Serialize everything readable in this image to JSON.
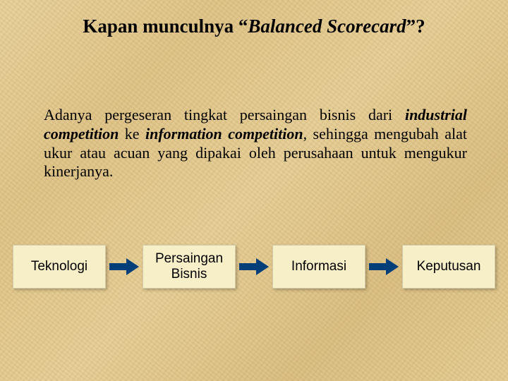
{
  "title": {
    "pre": "Kapan munculnya “",
    "italic": "Balanced Scorecard",
    "post": "”?"
  },
  "paragraph": {
    "p1": "Adanya pergeseran tingkat persaingan bisnis dari ",
    "industrial_competition": "industrial competition",
    "ke": " ke ",
    "information_competition": "information competition",
    "p2": ", sehingga mengubah alat ukur atau acuan yang dipakai oleh perusahaan untuk mengukur kinerjanya."
  },
  "flow": {
    "items": [
      {
        "label": "Teknologi"
      },
      {
        "label": "Persaingan Bisnis"
      },
      {
        "label": "Informasi"
      },
      {
        "label": "Keputusan"
      }
    ],
    "arrow_color": "#003e7a"
  }
}
